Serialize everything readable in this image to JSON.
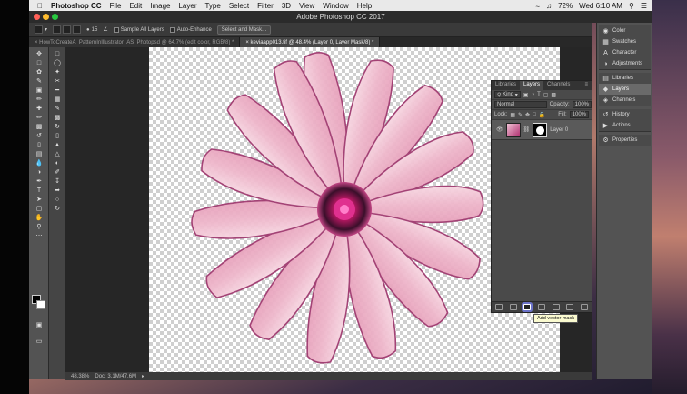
{
  "menubar": {
    "apple": "",
    "app": "Photoshop CC",
    "items": [
      "File",
      "Edit",
      "Image",
      "Layer",
      "Type",
      "Select",
      "Filter",
      "3D",
      "View",
      "Window",
      "Help"
    ],
    "battery": "72%",
    "clock": "Wed 6:10 AM"
  },
  "window": {
    "title": "Adobe Photoshop CC 2017"
  },
  "options": {
    "brush_size": "15",
    "sample_label": "Sample All Layers",
    "auto_label": "Auto-Enhance",
    "refine_label": "Select and Mask..."
  },
  "tabs": [
    {
      "label": "HowToCreateA_PatternInIllustrator_AS_Photopsd @ 64.7% (edit color, RGB/8) *"
    },
    {
      "label": "keviaapp013.tif @ 48.4% (Layer 0, Layer Mask/8) *"
    }
  ],
  "status": {
    "zoom": "48.38%",
    "doc": "Doc: 3.1M/47.6M"
  },
  "layers_panel": {
    "tabs": [
      "Libraries",
      "Layers",
      "Channels"
    ],
    "filter": "Kind",
    "blend": "Normal",
    "opacity_label": "Opacity:",
    "opacity": "100%",
    "lock_label": "Lock:",
    "fill_label": "Fill:",
    "fill": "100%",
    "layer_name": "Layer 0"
  },
  "tooltip": "Add vector mask",
  "dock": {
    "groups": [
      [
        "Color",
        "Swatches",
        "Character",
        "Adjustments"
      ],
      [
        "Libraries",
        "Layers",
        "Channels"
      ],
      [
        "History",
        "Actions"
      ],
      [
        "Properties"
      ]
    ]
  },
  "colors": {
    "ui_bg": "#535353",
    "panel": "#4a4a4a",
    "highlight": "#5a5a8a"
  }
}
